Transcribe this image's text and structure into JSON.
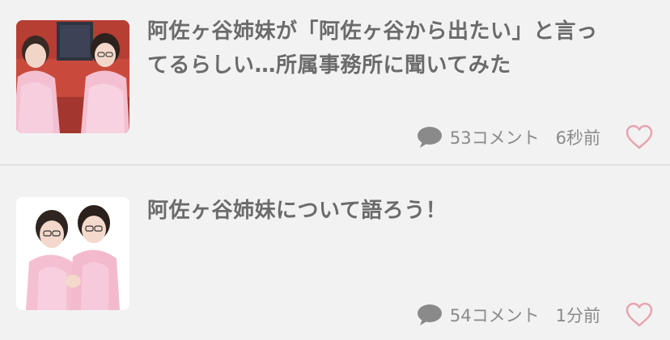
{
  "feed": {
    "items": [
      {
        "title_line1": "阿佐ヶ谷姉妹が「阿佐ヶ谷から出たい」と言っ",
        "title_line2": "てるらしい…所属事務所に聞いてみた",
        "comments": "53コメント",
        "time": "6秒前",
        "comment_icon": "comment-bubble-icon",
        "like_icon": "heart-outline-icon"
      },
      {
        "title_line1": "阿佐ヶ谷姉妹について語ろう！",
        "comments": "54コメント",
        "time": "1分前",
        "comment_icon": "comment-bubble-icon",
        "like_icon": "heart-outline-icon"
      }
    ]
  },
  "colors": {
    "background": "#f3f2f2",
    "title_text": "#6b6b6b",
    "meta_text": "#8a8a8a",
    "heart": "#e8a3b0",
    "comment_icon": "#8a8a8a",
    "divider": "#e3e1e1"
  }
}
